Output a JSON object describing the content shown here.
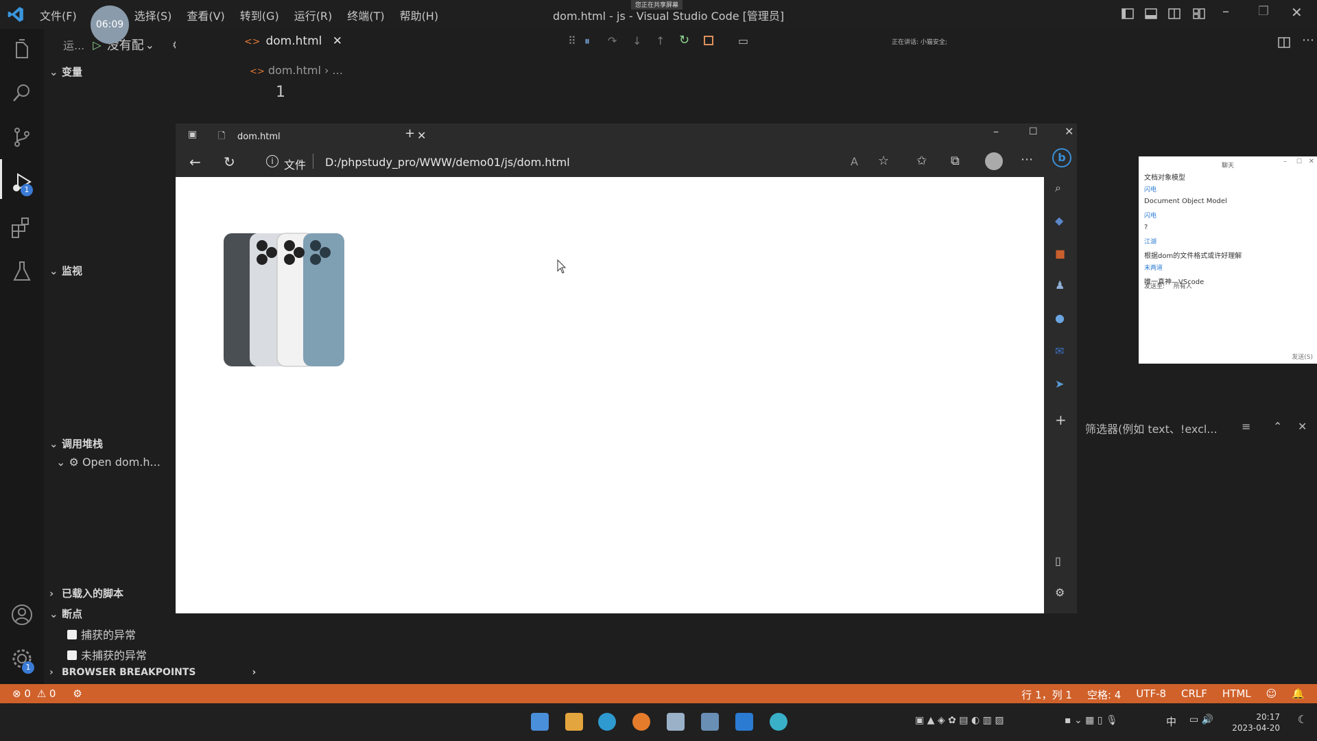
{
  "titlebar": {
    "menus": [
      "文件(F)",
      "选择(S)",
      "查看(V)",
      "转到(G)",
      "运行(R)",
      "终端(T)",
      "帮助(H)"
    ],
    "timer": "06:09",
    "title": "dom.html - js - Visual Studio Code [管理员]",
    "share_badge": "您正在共享屏幕"
  },
  "sidebar": {
    "run_label": "运...",
    "config_label": "没有配",
    "sections": {
      "variables": "变量",
      "watch": "监视",
      "callstack": "调用堆栈",
      "loaded_scripts": "已载入的脚本",
      "breakpoints": "断点",
      "browser_breakpoints": "BROWSER BREAKPOINTS"
    },
    "callstack_item": "Open dom.h...",
    "bp_caught": "捕获的异常",
    "bp_uncaught": "未捕获的异常"
  },
  "activity": {
    "debug_badge": "1",
    "settings_badge": "1"
  },
  "editor": {
    "tab_label": "dom.html",
    "breadcrumb_file": "dom.html",
    "breadcrumb_more": "...",
    "line_number": "1",
    "recording": "正在讲话: 小猫安全;"
  },
  "browser": {
    "tab_title": "dom.html",
    "file_label": "文件",
    "url": "D:/phpstudy_pro/WWW/demo01/js/dom.html"
  },
  "chat": {
    "header": "聊天",
    "messages": [
      {
        "name": "",
        "text": "文档对象模型"
      },
      {
        "name": "闪电",
        "text": ""
      },
      {
        "name": "",
        "text": "Document Object Model"
      },
      {
        "name": "闪电",
        "text": ""
      },
      {
        "name": "",
        "text": "?"
      },
      {
        "name": "江湖",
        "text": ""
      },
      {
        "name": "",
        "text": "根据dom的文件格式或许好理解"
      },
      {
        "name": "末两道",
        "text": ""
      },
      {
        "name": "",
        "text": "唯一真神—VScode"
      }
    ],
    "send_to_label": "发送至:",
    "send_to_value": "所有人",
    "send_button": "发送(S)"
  },
  "find": {
    "placeholder": "筛选器(例如 text、!excl..."
  },
  "statusbar": {
    "errors": "0",
    "warnings": "0",
    "position": "行 1，列 1",
    "spaces": "空格: 4",
    "encoding": "UTF-8",
    "eol": "CRLF",
    "language": "HTML"
  },
  "taskbar": {
    "ime": "中",
    "time": "20:17",
    "date": "2023-04-20"
  },
  "colors": {
    "status_bar": "#d0612b",
    "accent_html": "#e37933"
  }
}
